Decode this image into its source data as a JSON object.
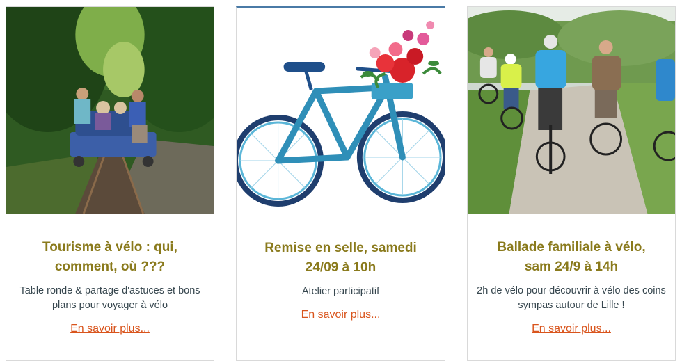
{
  "cards": [
    {
      "image_alt": "rail-bike-photo",
      "title_line1": "Tourisme à vélo : qui,",
      "title_line2": "comment, où ???",
      "desc_line1": "Table ronde & partage d'astuces et bons",
      "desc_line2": "plans pour voyager à vélo",
      "link": "En savoir plus..."
    },
    {
      "image_alt": "bicycle-with-flowers-illustration",
      "title_line1": "Remise en selle, samedi",
      "title_line2": "24/09 à 10h",
      "desc_line1": "Atelier participatif",
      "desc_line2": "",
      "link": "En savoir plus..."
    },
    {
      "image_alt": "group-cycling-photo",
      "title_line1": "Ballade familiale à vélo,",
      "title_line2": "sam 24/9 à 14h",
      "desc_line1": "2h de vélo pour découvrir à vélo des coins",
      "desc_line2": "sympas autour de Lille !",
      "link": "En savoir plus..."
    }
  ],
  "colors": {
    "title": "#8a7a1c",
    "link": "#d9541c",
    "text": "#37474f"
  }
}
